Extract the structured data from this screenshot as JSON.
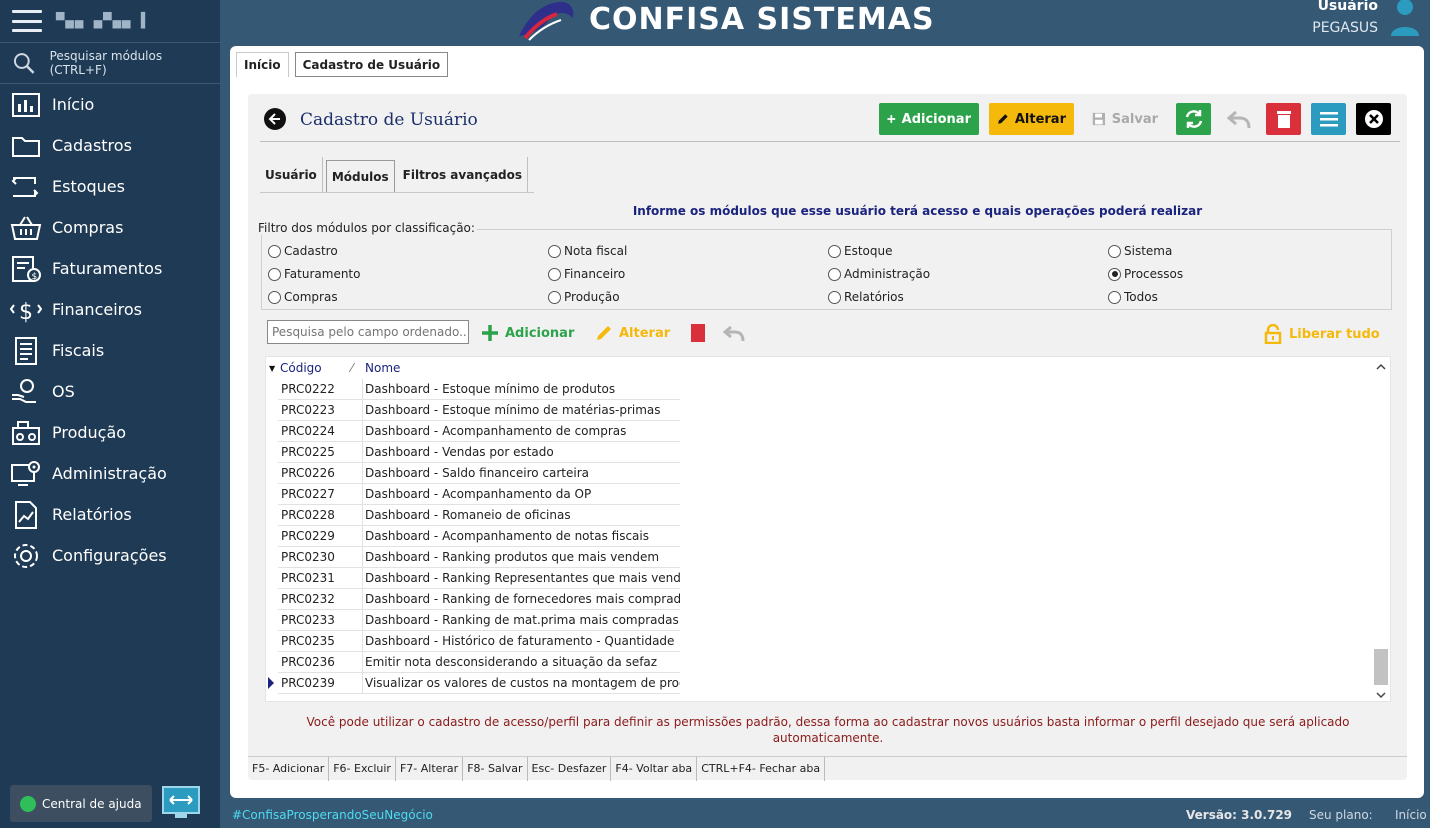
{
  "sidebar": {
    "user_masked": "▀▄▄ ▄▀▄▄ ▌",
    "search_placeholder": "Pesquisar módulos (CTRL+F)",
    "items": [
      {
        "label": "Início",
        "icon": "chart-icon"
      },
      {
        "label": "Cadastros",
        "icon": "folder-icon"
      },
      {
        "label": "Estoques",
        "icon": "stock-icon"
      },
      {
        "label": "Compras",
        "icon": "basket-icon"
      },
      {
        "label": "Faturamentos",
        "icon": "invoice-icon"
      },
      {
        "label": "Financeiros",
        "icon": "money-icon"
      },
      {
        "label": "Fiscais",
        "icon": "document-icon"
      },
      {
        "label": "OS",
        "icon": "service-icon"
      },
      {
        "label": "Produção",
        "icon": "production-icon"
      },
      {
        "label": "Administração",
        "icon": "admin-icon"
      },
      {
        "label": "Relatórios",
        "icon": "report-icon"
      },
      {
        "label": "Configurações",
        "icon": "gear-icon"
      }
    ],
    "help_label": "Central de ajuda"
  },
  "header": {
    "logo_text": "CONFISA SISTEMAS",
    "user_label": "Usuário",
    "user_name": "PEGASUS"
  },
  "top_tabs": [
    "Início",
    "Cadastro de Usuário"
  ],
  "form": {
    "title": "Cadastro de Usuário",
    "toolbar": {
      "add": "Adicionar",
      "alter": "Alterar",
      "save": "Salvar"
    },
    "sub_tabs": [
      "Usuário",
      "Módulos",
      "Filtros avançados"
    ],
    "info": "Informe os módulos que esse usuário terá acesso e quais operações poderá realizar",
    "filter_legend": "Filtro dos módulos por classificação:",
    "filters": [
      {
        "label": "Cadastro",
        "checked": false
      },
      {
        "label": "Nota fiscal",
        "checked": false
      },
      {
        "label": "Estoque",
        "checked": false
      },
      {
        "label": "Sistema",
        "checked": false
      },
      {
        "label": "Faturamento",
        "checked": false
      },
      {
        "label": "Financeiro",
        "checked": false
      },
      {
        "label": "Administração",
        "checked": false
      },
      {
        "label": "Processos",
        "checked": true
      },
      {
        "label": "Compras",
        "checked": false
      },
      {
        "label": "Produção",
        "checked": false
      },
      {
        "label": "Relatórios",
        "checked": false
      },
      {
        "label": "Todos",
        "checked": false
      }
    ],
    "grid_search_placeholder": "Pesquisa pelo campo ordenado...",
    "grid_add": "Adicionar",
    "grid_alter": "Alterar",
    "release_all": "Liberar tudo",
    "columns": [
      "Código",
      "Nome"
    ],
    "rows": [
      [
        "PRC0222",
        "Dashboard - Estoque mínimo de produtos"
      ],
      [
        "PRC0223",
        "Dashboard - Estoque mínimo de matérias-primas"
      ],
      [
        "PRC0224",
        "Dashboard - Acompanhamento de compras"
      ],
      [
        "PRC0225",
        "Dashboard - Vendas por estado"
      ],
      [
        "PRC0226",
        "Dashboard - Saldo financeiro carteira"
      ],
      [
        "PRC0227",
        "Dashboard - Acompanhamento da OP"
      ],
      [
        "PRC0228",
        "Dashboard - Romaneio de oficinas"
      ],
      [
        "PRC0229",
        "Dashboard - Acompanhamento de notas fiscais"
      ],
      [
        "PRC0230",
        "Dashboard - Ranking produtos que mais vendem"
      ],
      [
        "PRC0231",
        "Dashboard - Ranking Representantes que mais vendem"
      ],
      [
        "PRC0232",
        "Dashboard - Ranking de fornecedores mais comprados"
      ],
      [
        "PRC0233",
        "Dashboard - Ranking de mat.prima mais compradas"
      ],
      [
        "PRC0235",
        "Dashboard - Histórico de faturamento - Quantidade"
      ],
      [
        "PRC0236",
        "Emitir nota desconsiderando a situação da sefaz"
      ],
      [
        "PRC0239",
        "Visualizar os valores de custos na montagem de produto"
      ]
    ],
    "note": "Você pode utilizar o cadastro de acesso/perfil para definir as permissões padrão, dessa forma ao cadastrar novos usuários  basta informar o perfil desejado que será aplicado automaticamente.",
    "shortcuts": [
      "F5- Adicionar",
      "F6- Excluir",
      "F7- Alterar",
      "F8- Salvar",
      "Esc- Desfazer",
      "F4- Voltar aba",
      "CTRL+F4- Fechar aba"
    ]
  },
  "footer": {
    "hashtag": "#ConfisaProsperandoSeuNegócio",
    "version": "Versão: 3.0.729",
    "plan_label": "Seu plano:",
    "plan_value": "Início"
  },
  "colors": {
    "sidebar": "#1f3a54",
    "header": "#355875",
    "add": "#2ca34a",
    "alter": "#f5b90b",
    "delete": "#d9303c",
    "menu": "#2b9bc0"
  }
}
